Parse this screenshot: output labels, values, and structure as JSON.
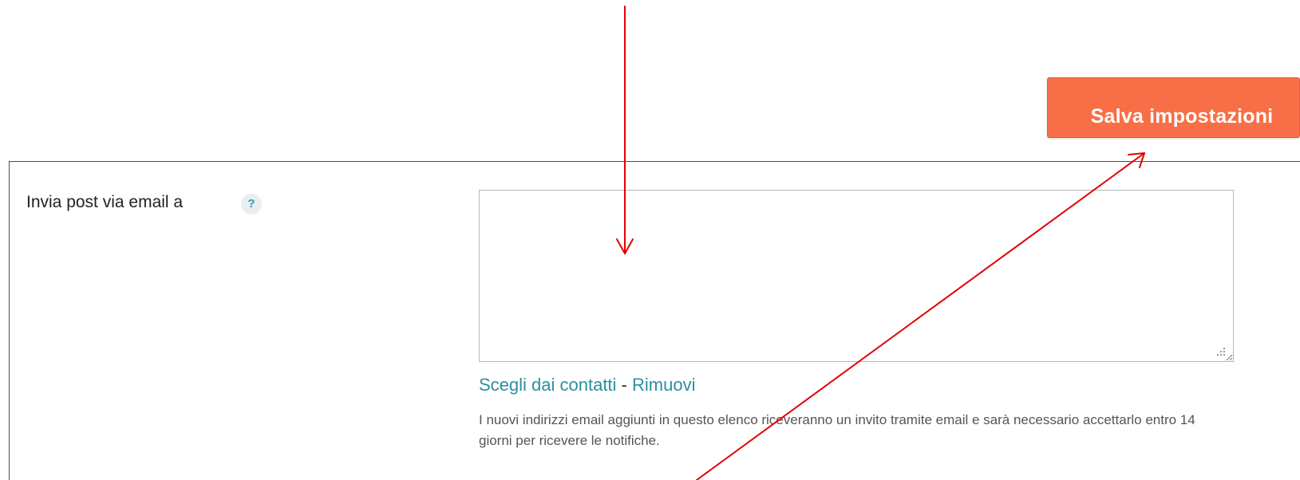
{
  "toolbar": {
    "save_label": "Salva impostazioni"
  },
  "email_section": {
    "label": "Invia post via email a",
    "help_glyph": "?",
    "textarea_value": "",
    "choose_contacts_link": "Scegli dai contatti",
    "separator": " - ",
    "remove_link": "Rimuovi",
    "hint_text": "I nuovi indirizzi email aggiunti in questo elenco riceveranno un invito tramite email e sarà necessario accettarlo entro 14 giorni per ricevere le notifiche."
  },
  "colors": {
    "save_button_bg": "#f86e46",
    "link": "#2c8f9f",
    "annotation_arrow": "#e30000"
  },
  "icons": {
    "help": "help-icon",
    "resize": "resize-grip-icon"
  }
}
